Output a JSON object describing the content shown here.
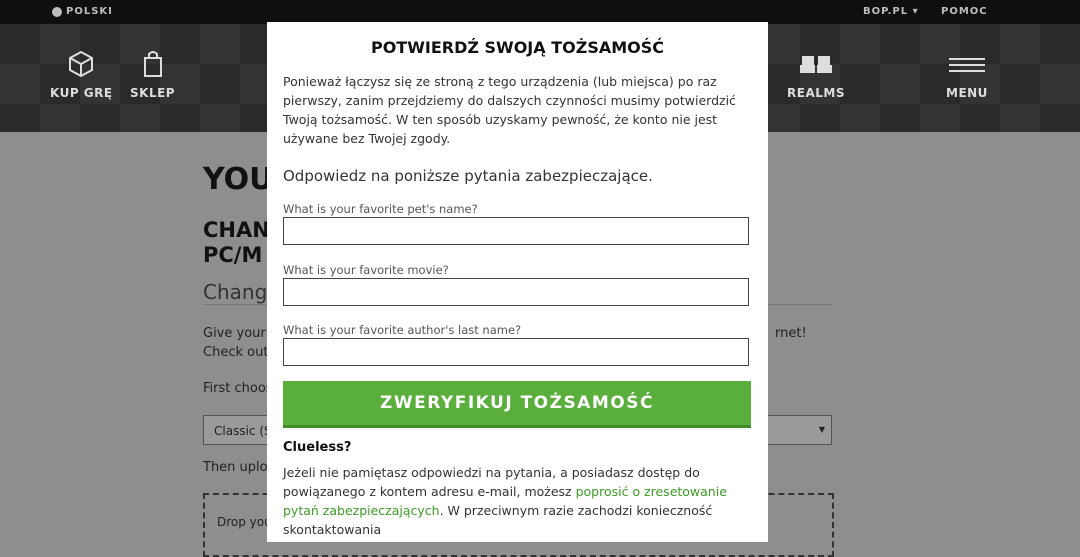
{
  "topbar": {
    "language": "POLSKI",
    "account": "BOP.PL",
    "help": "POMOC"
  },
  "nav": {
    "buy": "KUP GRĘ",
    "shop": "SKLEP",
    "realms": "REALMS",
    "menu": "MENU"
  },
  "page": {
    "title_fragment": "YOU",
    "section_fragment_1": "CHAN",
    "section_fragment_2": "PC/M",
    "subtitle_fragment": "Change",
    "line1_left": "Give your c",
    "line1_right": "rnet!",
    "line2_left": "Check out t",
    "line3_left": "First choos",
    "select_value": "Classic (St",
    "upload_left": "Then uploa",
    "drop_left": "Drop you"
  },
  "modal": {
    "title": "POTWIERDŹ SWOJĄ TOŻSAMOŚĆ",
    "intro": "Ponieważ łączysz się ze stroną z tego urządzenia (lub miejsca) po raz pierwszy, zanim przejdziemy do dalszych czynności musimy potwierdzić Twoją tożsamość. W ten sposób uzyskamy pewność, że konto nie jest używane bez Twojej zgody.",
    "prompt": "Odpowiedz na poniższe pytania zabezpieczające.",
    "questions": [
      {
        "label": "What is your favorite pet's name?",
        "value": ""
      },
      {
        "label": "What is your favorite movie?",
        "value": ""
      },
      {
        "label": "What is your favorite author's last name?",
        "value": ""
      }
    ],
    "verify_button": "ZWERYFIKUJ TOŻSAMOŚĆ",
    "clueless": "Clueless?",
    "help_before": "Jeżeli nie pamiętasz odpowiedzi na pytania, a posiadasz dostęp do powiązanego z kontem adresu e-mail, możesz ",
    "help_link": "poprosić o zresetowanie pytań zabezpieczających",
    "help_after": ". W przeciwnym razie zachodzi konieczność skontaktowania"
  },
  "colors": {
    "accent_green": "#5aae3b",
    "link_green": "#3e9a27"
  }
}
